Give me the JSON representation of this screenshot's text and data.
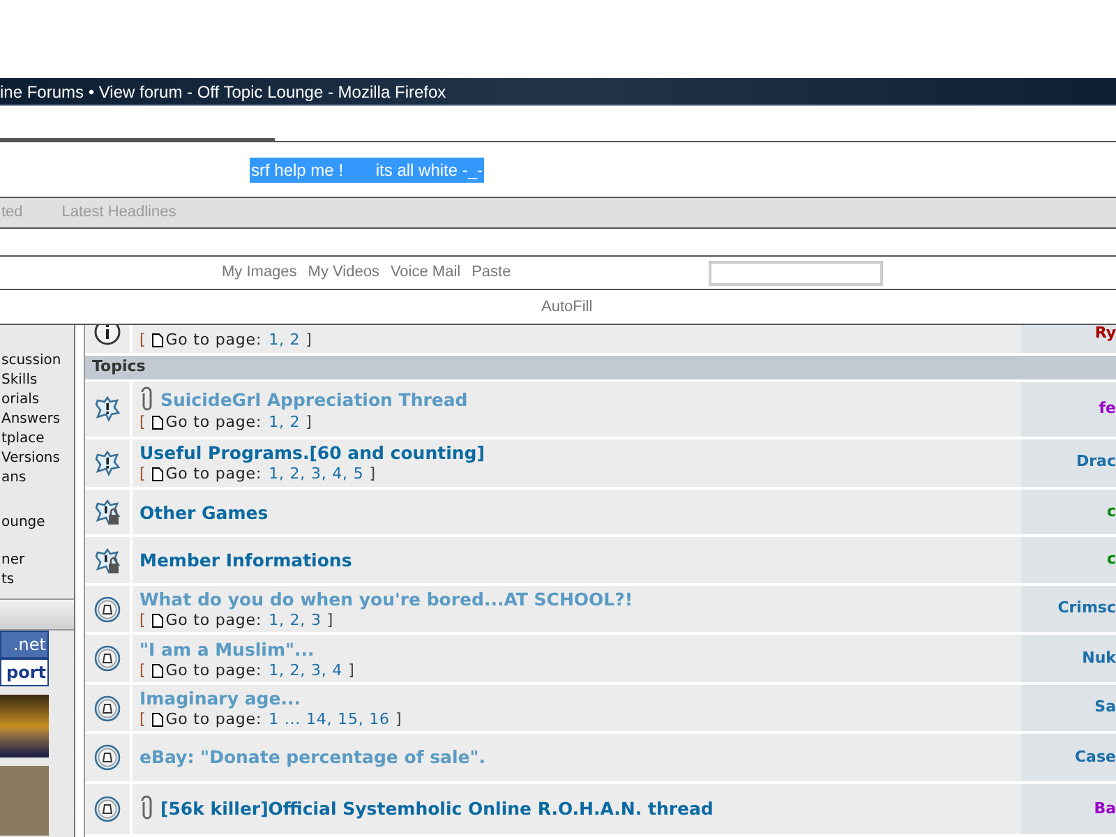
{
  "window": {
    "title": "ine Forums • View forum - Off Topic Lounge - Mozilla Firefox"
  },
  "selected_text": "srf help me !       its all white -_-",
  "headlines_bar": {
    "items": [
      "ted",
      "Latest Headlines"
    ]
  },
  "links_bar": {
    "items": [
      "My Images",
      "My Videos",
      "Voice Mail",
      "Paste"
    ]
  },
  "autofill": {
    "label": "AutoFill"
  },
  "sidebar": {
    "sections": [
      {
        "items": [
          "scussion",
          "Skills",
          "orials",
          "Answers",
          "tplace",
          "Versions",
          "ans"
        ]
      },
      {
        "items": [
          "ounge"
        ]
      },
      {
        "items": [
          "ner",
          "ts"
        ]
      }
    ],
    "links": [
      {
        "label": ".net",
        "selected": true
      },
      {
        "label": "port",
        "selected": false
      }
    ]
  },
  "announcement": {
    "kind": "info",
    "pagination": {
      "open": "[",
      "label": "Go to page:",
      "pages": "1, 2",
      "close": "]"
    },
    "author": "Ry",
    "color": "#aa0000"
  },
  "topics_header": "Topics",
  "topics": [
    {
      "kind": "sticky",
      "attachment": true,
      "visited": true,
      "title": "SuicideGrl Appreciation Thread",
      "pagination": {
        "open": "[",
        "label": "Go to page:",
        "pages": "1, 2",
        "close": "]"
      },
      "author": "fe",
      "color": "#9900cc"
    },
    {
      "kind": "sticky",
      "attachment": false,
      "visited": false,
      "title": "Useful Programs.[60 and counting]",
      "pagination": {
        "open": "[",
        "label": "Go to page:",
        "pages": "1, 2, 3, 4, 5",
        "close": "]"
      },
      "author": "Drac",
      "color": "#1a6fa8"
    },
    {
      "kind": "locked",
      "attachment": false,
      "visited": false,
      "title": "Other Games",
      "author": "c",
      "color": "#008800"
    },
    {
      "kind": "locked",
      "attachment": false,
      "visited": false,
      "title": "Member Informations",
      "author": "c",
      "color": "#008800"
    },
    {
      "kind": "topic",
      "attachment": false,
      "visited": true,
      "title": "What do you do when you're bored...AT SCHOOL?!",
      "pagination": {
        "open": "[",
        "label": "Go to page:",
        "pages": "1, 2, 3",
        "close": "]"
      },
      "author": "Crimsc",
      "color": "#1a6fa8"
    },
    {
      "kind": "topic",
      "attachment": false,
      "visited": true,
      "title": "\"I am a Muslim\"...",
      "pagination": {
        "open": "[",
        "label": "Go to page:",
        "pages": "1, 2, 3, 4",
        "close": "]"
      },
      "author": "Nuk",
      "color": "#1a6fa8"
    },
    {
      "kind": "topic",
      "attachment": false,
      "visited": true,
      "title": "Imaginary age...",
      "pagination": {
        "open": "[",
        "label": "Go to page:",
        "pages": "1 ... 14, 15, 16",
        "close": "]"
      },
      "author": "Sa",
      "color": "#1a6fa8"
    },
    {
      "kind": "topic",
      "attachment": false,
      "visited": true,
      "title": "eBay: \"Donate percentage of sale\".",
      "author": "Case",
      "color": "#1a6fa8"
    },
    {
      "kind": "topic",
      "attachment": true,
      "visited": false,
      "title": "[56k killer]Official Systemholic Online R.O.H.A.N. thread",
      "author": "Ba",
      "color": "#9900cc"
    }
  ]
}
